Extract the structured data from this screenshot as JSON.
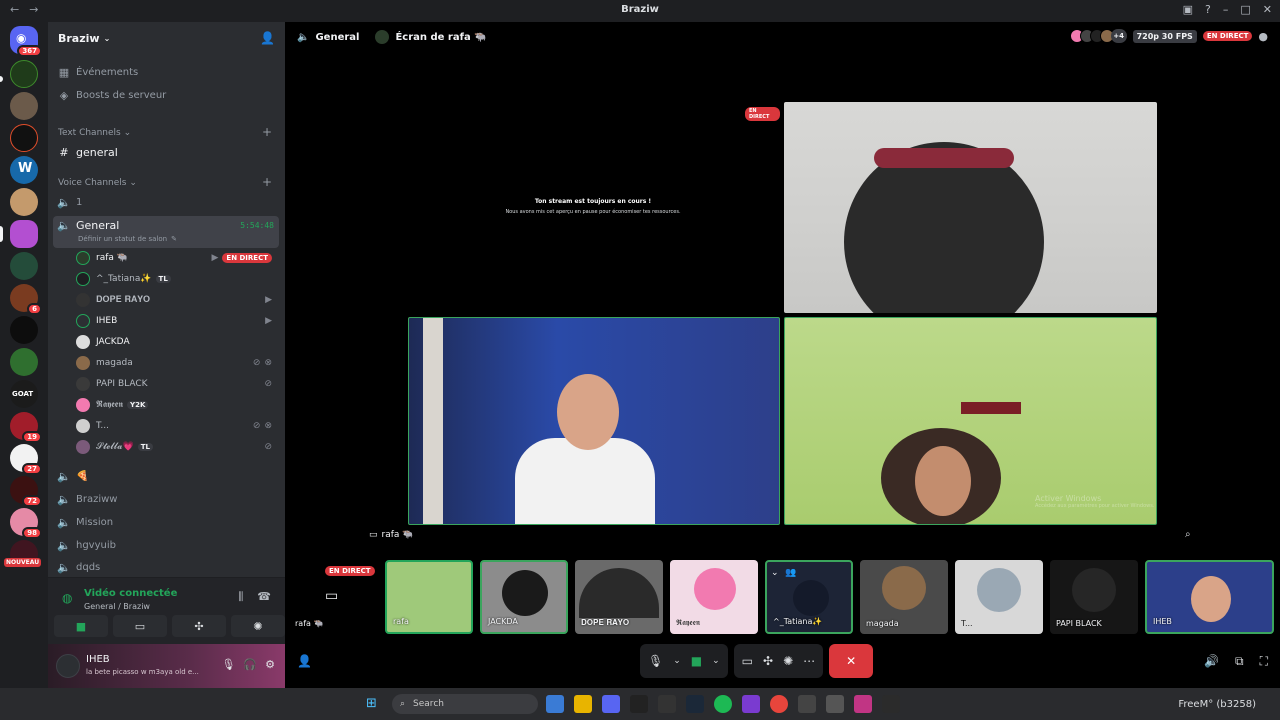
{
  "window": {
    "title": "Braziw"
  },
  "rail": {
    "badges": {
      "home": "367",
      "s9": "6",
      "s15": "19",
      "s16": "27",
      "s17": "72",
      "s18": "98"
    },
    "nouveau": "NOUVEAU"
  },
  "server": {
    "name": "Braziw",
    "events": "Événements",
    "boosts": "Boosts de serveur",
    "text_category": "Text Channels",
    "text_channel": "general",
    "voice_category": "Voice Channels",
    "channels": [
      "1",
      "General",
      "🍕",
      "Braziww",
      "Mission",
      "hgvyuib",
      "dqds"
    ],
    "general_timer": "5:54:48",
    "general_status": "Définir un statut de salon"
  },
  "voice_users": [
    {
      "name": "rafa 🐃",
      "right": "EN DIRECT"
    },
    {
      "name": "^_Tatiana✨",
      "tag": "TL"
    },
    {
      "name": "𝐃𝐎𝐏𝐄 𝐑𝐀𝐘𝐎"
    },
    {
      "name": "IHEB"
    },
    {
      "name": "JACKDA"
    },
    {
      "name": "magada"
    },
    {
      "name": "PAPI BLACK"
    },
    {
      "name": "𝕽𝖆𝖞𝖊𝖊𝖓",
      "tag": "Y2K"
    },
    {
      "name": "T..."
    },
    {
      "name": "𝓢𝓽𝓮𝓵𝓵𝓪💗",
      "tag": "TL"
    }
  ],
  "voice_panel": {
    "title": "Vidéo connectée",
    "sub": "General / Braziw"
  },
  "user_panel": {
    "name": "IHEB",
    "status": "la bete picasso w m3aya old e..."
  },
  "stage": {
    "channel": "General",
    "screen": "Écran de rafa 🐃",
    "quality": "720p 30 FPS",
    "live": "EN DIRECT",
    "extra_count": "+4",
    "paused_title": "Ton stream est toujours en cours !",
    "paused_sub": "Nous avons mis cet aperçu en pause pour économiser tes ressources.",
    "stream_label": "rafa 🐃",
    "watermark_title": "Activer Windows",
    "watermark_sub": "Accédez aux paramètres pour activer Windows."
  },
  "strip": [
    {
      "label": "rafa 🐃",
      "live": "EN DIRECT"
    },
    {
      "label": "rafa"
    },
    {
      "label": "JACKDA"
    },
    {
      "label": "𝐃𝐎𝐏𝐄 𝐑𝐀𝐘𝐎"
    },
    {
      "label": "𝕽𝖆𝖞𝖊𝖊𝖓"
    },
    {
      "label": "^_Tatiana✨"
    },
    {
      "label": "magada"
    },
    {
      "label": "T..."
    },
    {
      "label": "PAPI BLACK"
    },
    {
      "label": "IHEB"
    }
  ],
  "taskbar": {
    "search": "Search",
    "right_text": "FreeM° (b3258)"
  },
  "colors": {
    "green": "#23a55a",
    "red": "#da373c",
    "bg": "#2b2d31"
  }
}
